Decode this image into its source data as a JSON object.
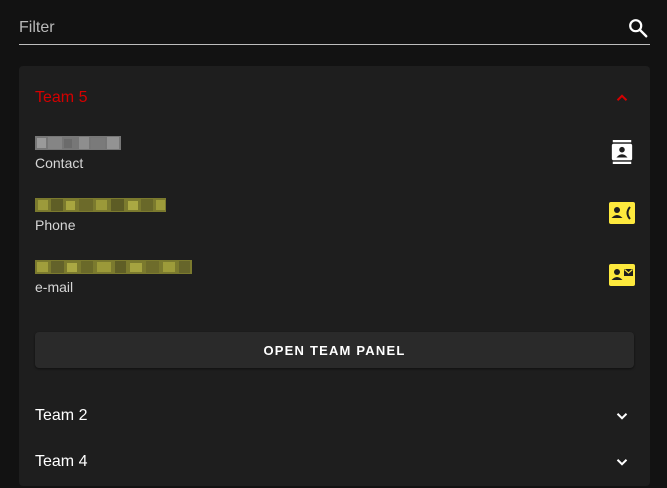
{
  "filter": {
    "placeholder": "Filter",
    "value": ""
  },
  "icons": {
    "search": "search-icon",
    "contact": "contact-card-icon",
    "phone": "phone-card-icon",
    "email": "email-card-icon",
    "expand": "chevron-down-icon",
    "collapse": "chevron-up-icon"
  },
  "colors": {
    "active_team": "#d50000",
    "accent_icon": "#fde93d",
    "background": "#121212",
    "panel": "#1e1e1e"
  },
  "teams": [
    {
      "name": "Team 5",
      "expanded": true,
      "rows": [
        {
          "label": "Contact"
        },
        {
          "label": "Phone"
        },
        {
          "label": "e-mail"
        }
      ],
      "button_label": "OPEN TEAM PANEL"
    },
    {
      "name": "Team 2",
      "expanded": false
    },
    {
      "name": "Team 4",
      "expanded": false
    }
  ]
}
